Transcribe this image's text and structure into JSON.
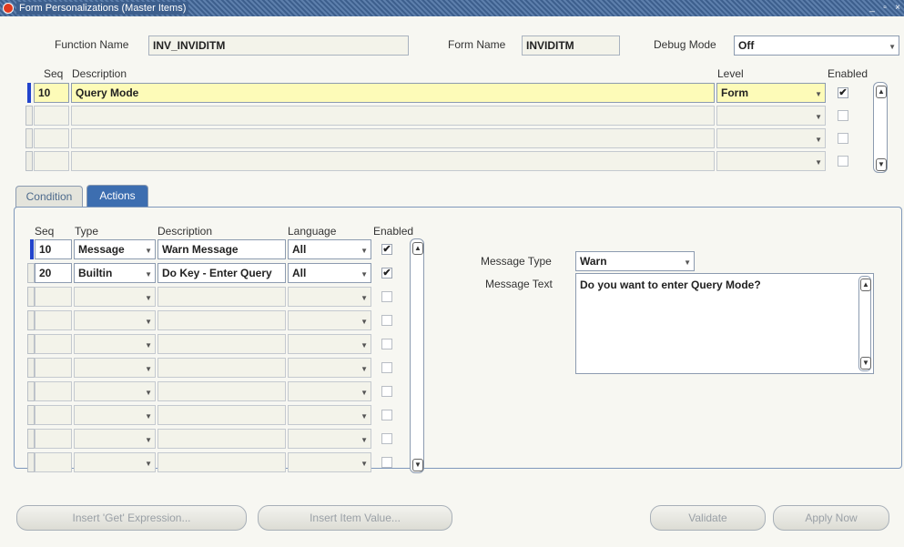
{
  "window": {
    "title": "Form Personalizations (Master Items)"
  },
  "header": {
    "function_name_label": "Function Name",
    "function_name": "INV_INVIDITM",
    "form_name_label": "Form Name",
    "form_name": "INVIDITM",
    "debug_mode_label": "Debug Mode",
    "debug_mode": "Off"
  },
  "rules": {
    "col_seq": "Seq",
    "col_description": "Description",
    "col_level": "Level",
    "col_enabled": "Enabled",
    "rows": [
      {
        "seq": "10",
        "description": "Query Mode",
        "level": "Form",
        "enabled": true
      },
      {
        "seq": "",
        "description": "",
        "level": "",
        "enabled": false
      },
      {
        "seq": "",
        "description": "",
        "level": "",
        "enabled": false
      },
      {
        "seq": "",
        "description": "",
        "level": "",
        "enabled": false
      }
    ]
  },
  "tabs": [
    {
      "label": "Condition"
    },
    {
      "label": "Actions"
    }
  ],
  "actions": {
    "col_seq": "Seq",
    "col_type": "Type",
    "col_description": "Description",
    "col_language": "Language",
    "col_enabled": "Enabled",
    "rows": [
      {
        "seq": "10",
        "type": "Message",
        "description": "Warn Message",
        "language": "All",
        "enabled": true
      },
      {
        "seq": "20",
        "type": "Builtin",
        "description": "Do Key - Enter Query",
        "language": "All",
        "enabled": true
      },
      {
        "seq": "",
        "type": "",
        "description": "",
        "language": "",
        "enabled": false
      },
      {
        "seq": "",
        "type": "",
        "description": "",
        "language": "",
        "enabled": false
      },
      {
        "seq": "",
        "type": "",
        "description": "",
        "language": "",
        "enabled": false
      },
      {
        "seq": "",
        "type": "",
        "description": "",
        "language": "",
        "enabled": false
      },
      {
        "seq": "",
        "type": "",
        "description": "",
        "language": "",
        "enabled": false
      },
      {
        "seq": "",
        "type": "",
        "description": "",
        "language": "",
        "enabled": false
      },
      {
        "seq": "",
        "type": "",
        "description": "",
        "language": "",
        "enabled": false
      },
      {
        "seq": "",
        "type": "",
        "description": "",
        "language": "",
        "enabled": false
      }
    ],
    "message_type_label": "Message Type",
    "message_type": "Warn",
    "message_text_label": "Message Text",
    "message_text": "Do you want to enter Query Mode?"
  },
  "buttons": {
    "insert_get_expression": "Insert 'Get' Expression...",
    "insert_item_value": "Insert Item Value...",
    "validate": "Validate",
    "apply_now": "Apply Now"
  },
  "icons": {
    "check": "✔",
    "dropdown": "▼",
    "up": "▲",
    "down": "▼"
  }
}
